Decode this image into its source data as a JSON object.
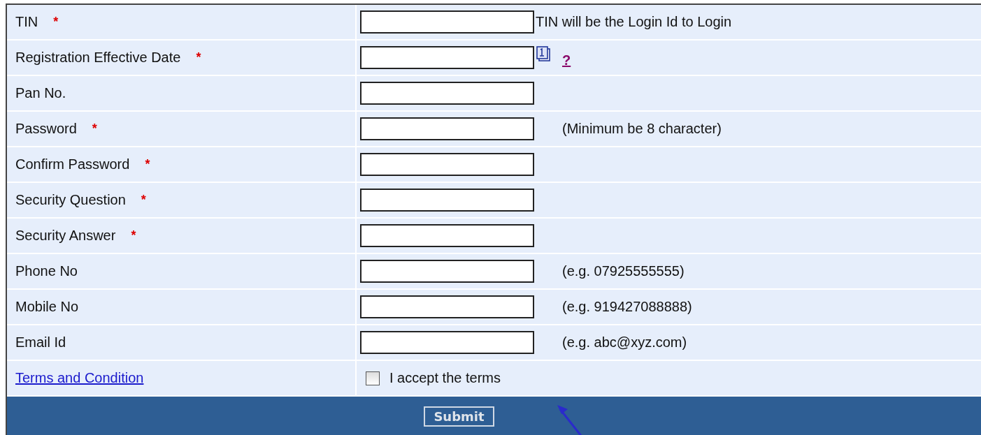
{
  "rows": [
    {
      "kind": "login",
      "label": "TIN",
      "marker": "*",
      "value": "",
      "hint": "TIN will be the Login Id to Login"
    },
    {
      "kind": "date",
      "label": "Registration Effective Date",
      "marker": "*",
      "value": "",
      "help": "?"
    },
    {
      "kind": "field",
      "label": "Pan No.",
      "value": ""
    },
    {
      "kind": "field",
      "label": "Password",
      "marker": "*",
      "value": "",
      "hint": "(Minimum be 8 character)"
    },
    {
      "kind": "field",
      "label": "Confirm Password",
      "marker": "*",
      "value": ""
    },
    {
      "kind": "field",
      "label": "Security Question",
      "marker": "*",
      "value": ""
    },
    {
      "kind": "field",
      "label": "Security Answer",
      "marker": "*",
      "value": ""
    },
    {
      "kind": "field",
      "label": "Phone No",
      "value": "",
      "hint": "(e.g. 07925555555)"
    },
    {
      "kind": "field",
      "label": "Mobile No",
      "value": "",
      "hint": "(e.g. 919427088888)"
    },
    {
      "kind": "field",
      "label": "Email Id",
      "value": "",
      "hint": "(e.g. abc@xyz.com)"
    }
  ],
  "terms": {
    "link": "Terms and Condition",
    "checkbox_label": "I accept the terms",
    "checked": false
  },
  "submit": "Submit"
}
